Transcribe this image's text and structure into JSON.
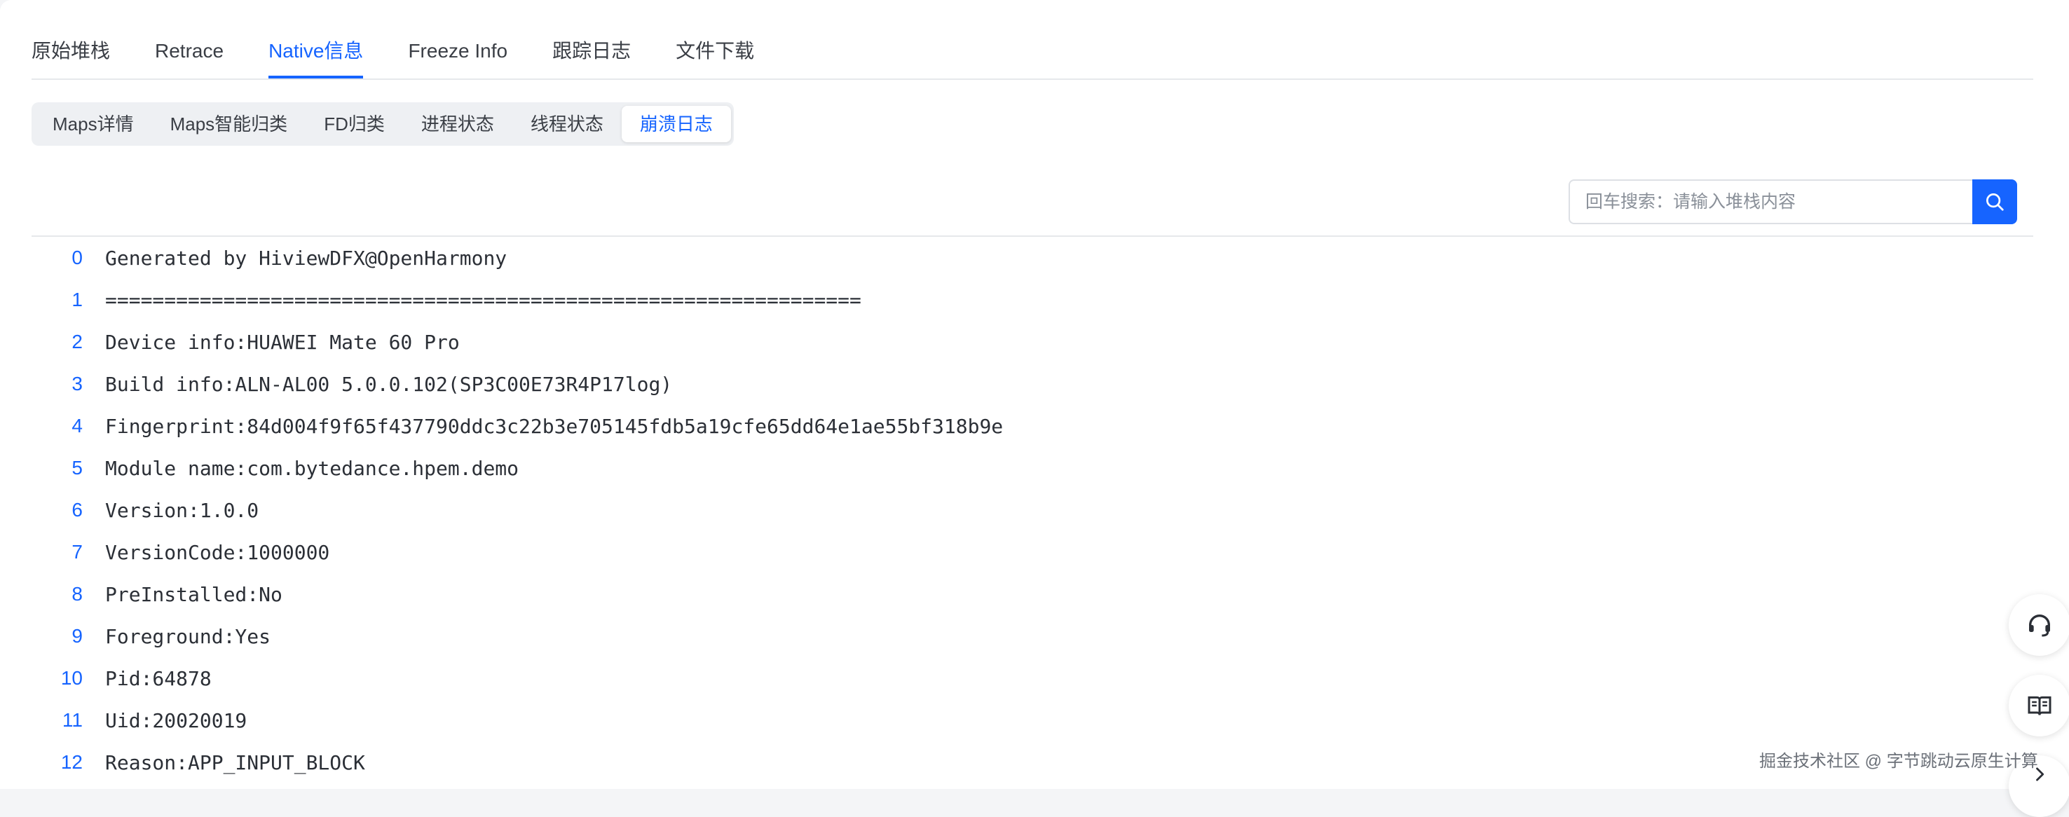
{
  "top_tabs": [
    "原始堆栈",
    "Retrace",
    "Native信息",
    "Freeze Info",
    "跟踪日志",
    "文件下载"
  ],
  "top_tabs_active_index": 2,
  "sub_tabs": [
    "Maps详情",
    "Maps智能归类",
    "FD归类",
    "进程状态",
    "线程状态",
    "崩溃日志"
  ],
  "sub_tabs_active_index": 5,
  "search": {
    "placeholder": "回车搜索：请输入堆栈内容",
    "button_icon": "search-icon"
  },
  "log_lines": [
    {
      "num": "0",
      "text": "Generated by HiviewDFX@OpenHarmony"
    },
    {
      "num": "1",
      "text": "================================================================"
    },
    {
      "num": "2",
      "text": "Device info:HUAWEI Mate 60 Pro"
    },
    {
      "num": "3",
      "text": "Build info:ALN-AL00 5.0.0.102(SP3C00E73R4P17log)"
    },
    {
      "num": "4",
      "text": "Fingerprint:84d004f9f65f437790ddc3c22b3e705145fdb5a19cfe65dd64e1ae55bf318b9e"
    },
    {
      "num": "5",
      "text": "Module name:com.bytedance.hpem.demo"
    },
    {
      "num": "6",
      "text": "Version:1.0.0"
    },
    {
      "num": "7",
      "text": "VersionCode:1000000"
    },
    {
      "num": "8",
      "text": "PreInstalled:No"
    },
    {
      "num": "9",
      "text": "Foreground:Yes"
    },
    {
      "num": "10",
      "text": "Pid:64878"
    },
    {
      "num": "11",
      "text": "Uid:20020019"
    },
    {
      "num": "12",
      "text": "Reason:APP_INPUT_BLOCK"
    }
  ],
  "floating_buttons": [
    "support-headset-icon",
    "book-icon",
    "chevron-right-icon"
  ],
  "watermark": "掘金技术社区 @ 字节跳动云原生计算",
  "colors": {
    "accent": "#1664ff",
    "text": "#2b2f36",
    "border": "#e6e8eb"
  }
}
